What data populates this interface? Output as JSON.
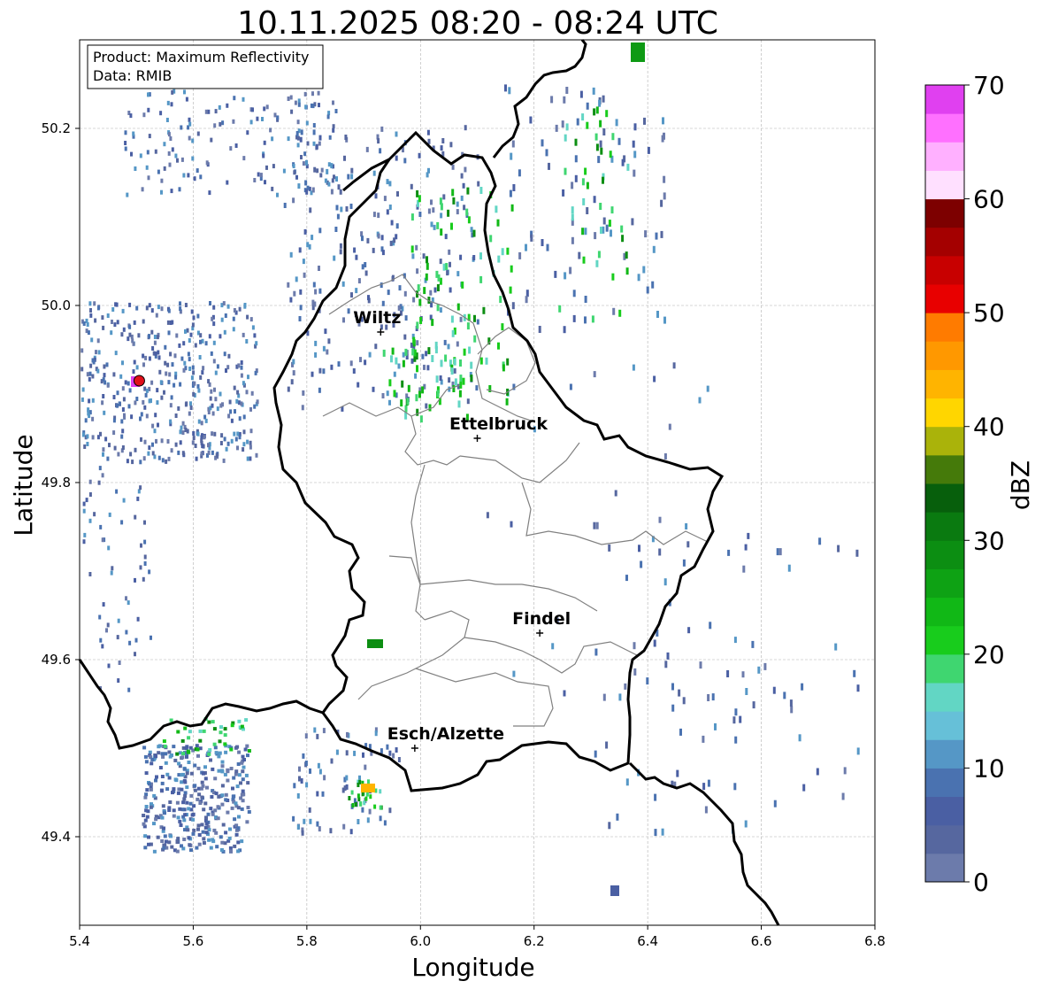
{
  "title": "10.11.2025 08:20 - 08:24 UTC",
  "info": {
    "product": "Product: Maximum Reflectivity",
    "data": "Data: RMIB"
  },
  "axes": {
    "xlabel": "Longitude",
    "ylabel": "Latitude",
    "xlim": [
      5.4,
      6.8
    ],
    "ylim": [
      49.3,
      50.3
    ],
    "xticks": [
      "5.4",
      "5.6",
      "5.8",
      "6.0",
      "6.2",
      "6.4",
      "6.6",
      "6.8"
    ],
    "yticks": [
      "49.4",
      "49.6",
      "49.8",
      "50.0",
      "50.2"
    ],
    "grid": true
  },
  "colorbar": {
    "label": "dBZ",
    "range": [
      0,
      70
    ],
    "ticks": [
      "0",
      "10",
      "20",
      "30",
      "40",
      "50",
      "60",
      "70"
    ],
    "colors": [
      "#6c7bab",
      "#56679f",
      "#4a5fa3",
      "#4a72b0",
      "#5597c6",
      "#66c0d8",
      "#62d6c4",
      "#3fd670",
      "#18cc1c",
      "#11b816",
      "#0ea214",
      "#0c8e12",
      "#0a7a10",
      "#075f0c",
      "#457a0a",
      "#aab30a",
      "#ffd600",
      "#ffb400",
      "#ff9800",
      "#ff7b00",
      "#e80000",
      "#c80000",
      "#a40000",
      "#7d0000",
      "#ffe0ff",
      "#ffb0ff",
      "#ff70ff",
      "#e040f0"
    ]
  },
  "cities": [
    {
      "name": "Wiltz",
      "lon": 5.93,
      "lat": 49.97
    },
    {
      "name": "Ettelbruck",
      "lon": 6.1,
      "lat": 49.85
    },
    {
      "name": "Findel",
      "lon": 6.21,
      "lat": 49.63
    },
    {
      "name": "Esch/Alzette",
      "lon": 5.99,
      "lat": 49.5
    }
  ],
  "radar_site": {
    "lon": 5.505,
    "lat": 49.915,
    "color": "#e0101a"
  },
  "border_color": "#000000",
  "canton_color": "#808080"
}
